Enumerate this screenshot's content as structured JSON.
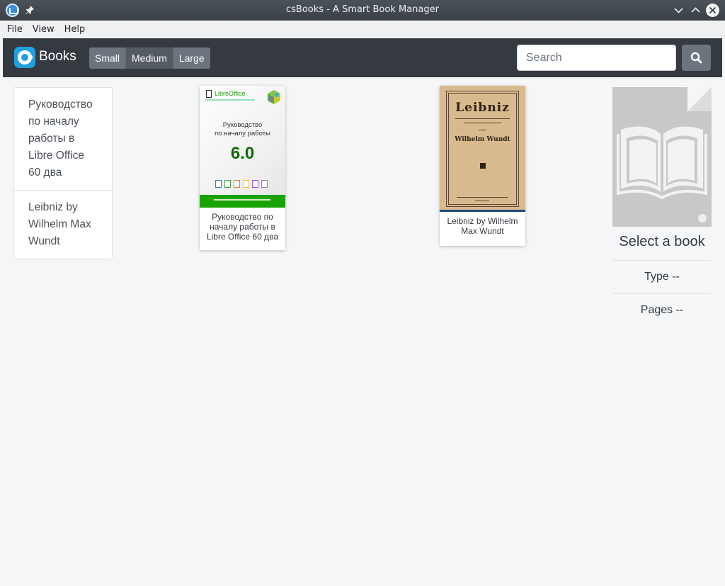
{
  "window": {
    "title": "csBooks - A Smart Book Manager"
  },
  "menu": {
    "items": [
      "File",
      "View",
      "Help"
    ]
  },
  "navbar": {
    "brand": "Books",
    "sizes": [
      {
        "label": "Small",
        "active": false
      },
      {
        "label": "Medium",
        "active": true
      },
      {
        "label": "Large",
        "active": false
      }
    ],
    "search_placeholder": "Search"
  },
  "book_list": [
    {
      "title": "Руководство по началу работы в Libre Office 60 два"
    },
    {
      "title": "Leibniz by Wilhelm Max Wundt"
    }
  ],
  "cards": [
    {
      "caption": "Руководство по началу работы в Libre Office 60 два",
      "cover": {
        "brand": "LibreOffice",
        "title_line1": "Руководство",
        "title_line2": "по началу работы",
        "version": "6.0"
      }
    },
    {
      "caption": "Leibniz by Wilhelm Max Wundt",
      "cover": {
        "title": "Leibniz",
        "author": "Wilhelm Wundt"
      }
    }
  ],
  "details": {
    "title": "Select a book",
    "type": "Type --",
    "pages": "Pages --"
  },
  "colors": {
    "navbar": "#343a40",
    "button": "#6c757d",
    "libreoffice_green": "#18a303"
  }
}
